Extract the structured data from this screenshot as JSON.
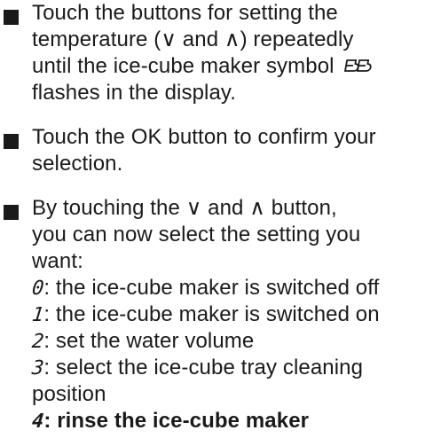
{
  "steps": [
    {
      "lines": [
        "Touch the buttons for setting the",
        "temperature (∨ and ∧) repeatedly",
        "until the ice-cube maker symbol",
        "flashes in the display."
      ],
      "icon": "ice-cube-maker-icon"
    },
    {
      "lines": [
        "Touch the OK button to confirm your",
        "selection."
      ]
    },
    {
      "lines": [
        "By touching the ∨ and  ∧ button,",
        "you can now select the setting you",
        "want:"
      ],
      "settings": [
        {
          "code": "0",
          "text": ": the ice-cube maker is switched off"
        },
        {
          "code": "1",
          "text": ": the ice-cube maker is switched on"
        },
        {
          "code": "2",
          "text": ": set the water volume"
        },
        {
          "code": "3",
          "text": ": select the ice-cube tray cleaning"
        },
        {
          "code": "",
          "text": "position"
        },
        {
          "code": "4",
          "text": ": rinse the ice-cube maker"
        }
      ]
    }
  ]
}
